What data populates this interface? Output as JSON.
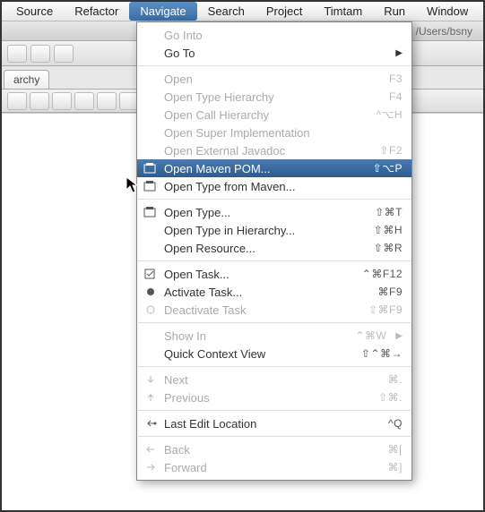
{
  "menubar": {
    "items": [
      "Source",
      "Refactor",
      "Navigate",
      "Search",
      "Project",
      "Timtam",
      "Run",
      "Window"
    ],
    "activeIndex": 2
  },
  "titlebar": {
    "text": "Java - Eclipse Platform - /Users/bsny"
  },
  "sidebar_tab": {
    "label": "archy"
  },
  "menu": {
    "groups": [
      [
        {
          "label": "Go Into",
          "icon": "",
          "shortcut": "",
          "disabled": true
        },
        {
          "label": "Go To",
          "icon": "",
          "shortcut": "",
          "submenu": true
        }
      ],
      [
        {
          "label": "Open",
          "icon": "",
          "shortcut": "F3",
          "disabled": true
        },
        {
          "label": "Open Type Hierarchy",
          "icon": "",
          "shortcut": "F4",
          "disabled": true
        },
        {
          "label": "Open Call Hierarchy",
          "icon": "",
          "shortcut": "^⌥H",
          "disabled": true
        },
        {
          "label": "Open Super Implementation",
          "icon": "",
          "shortcut": "",
          "disabled": true
        },
        {
          "label": "Open External Javadoc",
          "icon": "",
          "shortcut": "⇧F2",
          "disabled": true
        },
        {
          "label": "Open Maven POM...",
          "icon": "pom",
          "shortcut": "⇧⌥P",
          "selected": true
        },
        {
          "label": "Open Type from Maven...",
          "icon": "type",
          "shortcut": ""
        }
      ],
      [
        {
          "label": "Open Type...",
          "icon": "type",
          "shortcut": "⇧⌘T"
        },
        {
          "label": "Open Type in Hierarchy...",
          "icon": "",
          "shortcut": "⇧⌘H"
        },
        {
          "label": "Open Resource...",
          "icon": "",
          "shortcut": "⇧⌘R"
        }
      ],
      [
        {
          "label": "Open Task...",
          "icon": "task",
          "shortcut": "⌃⌘F12"
        },
        {
          "label": "Activate Task...",
          "icon": "dot",
          "shortcut": "⌘F9"
        },
        {
          "label": "Deactivate Task",
          "icon": "circle",
          "shortcut": "⇧⌘F9",
          "disabled": true
        }
      ],
      [
        {
          "label": "Show In",
          "icon": "",
          "shortcut": "⌃⌘W",
          "submenu": true,
          "disabled": true
        },
        {
          "label": "Quick Context View",
          "icon": "",
          "shortcut": "⇧⌃⌘→"
        }
      ],
      [
        {
          "label": "Next",
          "icon": "down",
          "shortcut": "⌘.",
          "disabled": true
        },
        {
          "label": "Previous",
          "icon": "up",
          "shortcut": "⇧⌘.",
          "disabled": true
        }
      ],
      [
        {
          "label": "Last Edit Location",
          "icon": "lastedit",
          "shortcut": "^Q"
        }
      ],
      [
        {
          "label": "Back",
          "icon": "back",
          "shortcut": "⌘[",
          "disabled": true
        },
        {
          "label": "Forward",
          "icon": "fwd",
          "shortcut": "⌘]",
          "disabled": true
        }
      ]
    ]
  }
}
